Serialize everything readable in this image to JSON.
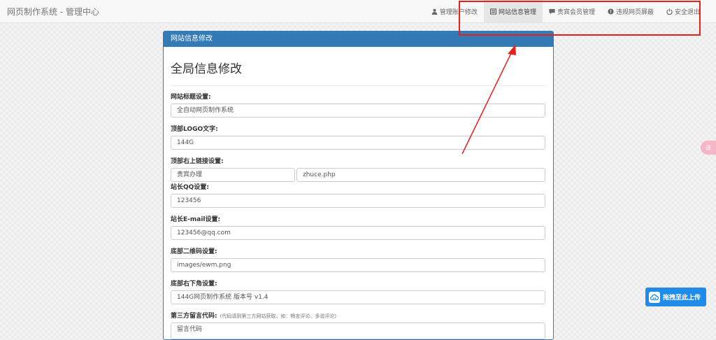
{
  "app": {
    "brand": "网页制作系统 - 管理中心"
  },
  "nav": {
    "items": [
      {
        "label": "管理账户修改",
        "icon": "user-icon",
        "active": false
      },
      {
        "label": "网站信息管理",
        "icon": "list-icon",
        "active": true
      },
      {
        "label": "贵宾会员管理",
        "icon": "comment-icon",
        "active": false
      },
      {
        "label": "违规网页屏蔽",
        "icon": "alert-icon",
        "active": false
      },
      {
        "label": "安全退出",
        "icon": "power-icon",
        "active": false
      }
    ]
  },
  "panel": {
    "heading": "网站信息修改",
    "title": "全局信息修改"
  },
  "form": {
    "site_title": {
      "label": "网站标题设置:",
      "value": "全自动网页制作系统"
    },
    "logo_text": {
      "label": "顶部LOGO文字:",
      "value": "144G"
    },
    "top_link": {
      "label": "顶部右上链接设置:",
      "text_value": "贵宾办理",
      "url_value": "zhuce.php"
    },
    "qq": {
      "label": "站长QQ设置:",
      "value": "123456"
    },
    "email": {
      "label": "站长E-mail设置:",
      "value": "123456@qq.com"
    },
    "qrcode": {
      "label": "底部二维码设置:",
      "value": "images/ewm.png"
    },
    "footer_right": {
      "label": "底部右下角设置:",
      "value": "144G网页制作系统  版本号 v1.4"
    },
    "comment_code": {
      "label": "第三方留言代码:",
      "hint": "(代码请到第三方网站获取，如：畅言评论、多说评论)",
      "value": "留言代码"
    }
  },
  "widgets": {
    "side_tab_text": "译",
    "upload_label": "拖拽至此上传",
    "annotation_color": "#e8201a",
    "accent": "#337ab7"
  }
}
